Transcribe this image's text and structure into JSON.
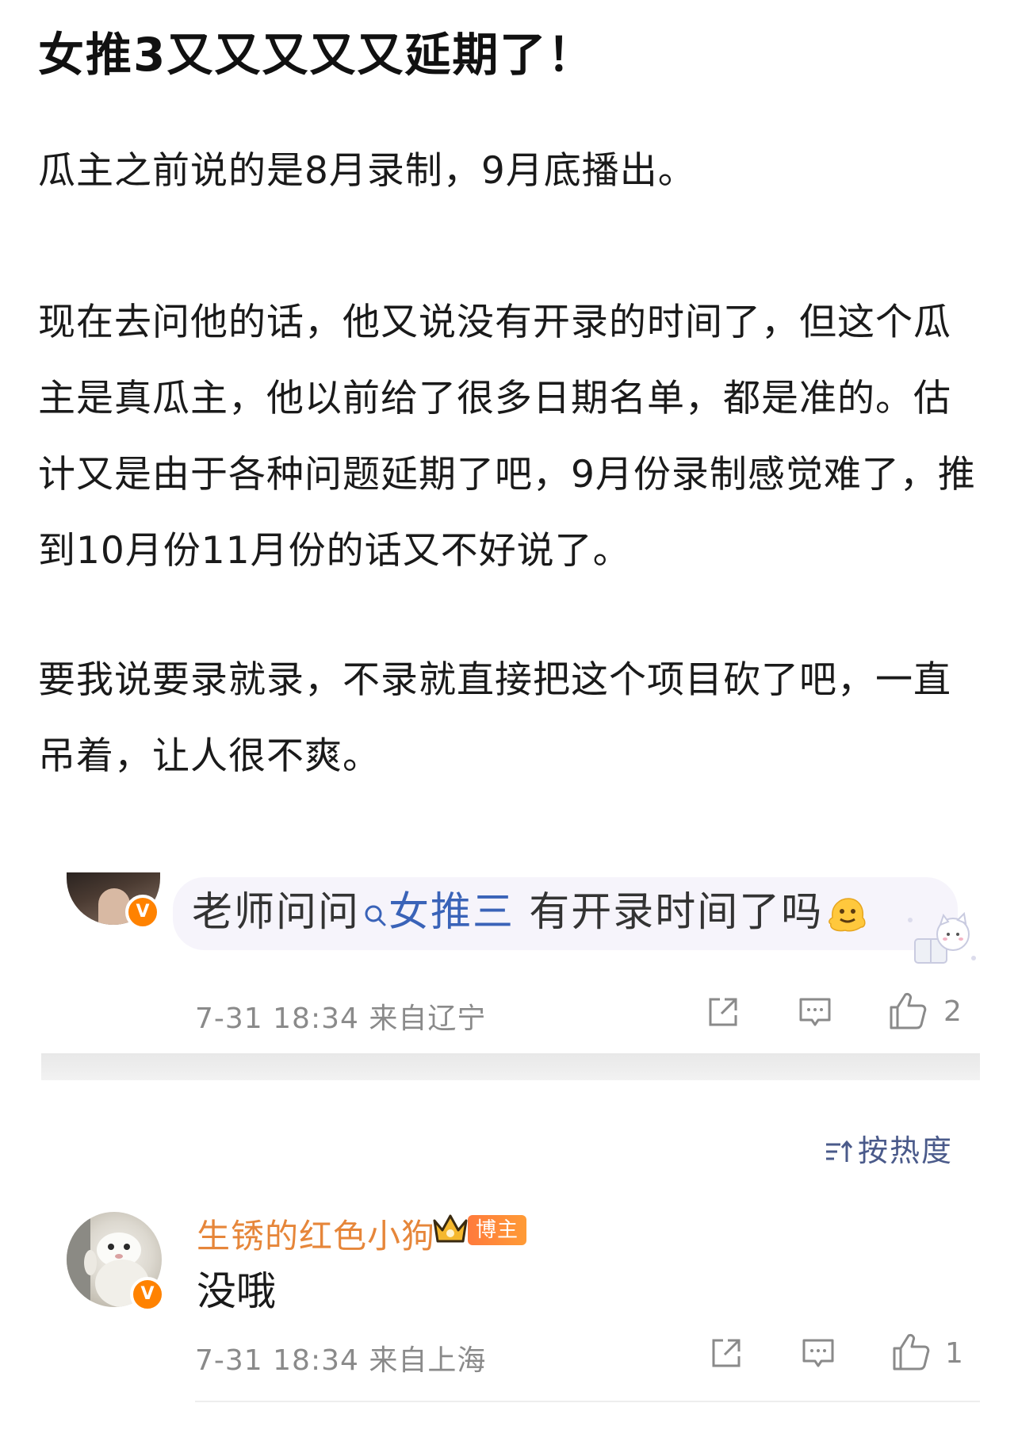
{
  "post": {
    "title": "女推3又又又又又延期了！",
    "paragraph1": "瓜主之前说的是8月录制，9月底播出。",
    "paragraph2": "现在去问他的话，他又说没有开录的时间了，但这个瓜主是真瓜主，他以前给了很多日期名单，都是准的。估计又是由于各种问题延期了吧，9月份录制感觉难了，推到10月份11月份的话又不好说了。",
    "paragraph3": "要我说要录就录，不录就直接把这个项目砍了吧，一直吊着，让人很不爽。"
  },
  "quoted_comment": {
    "text_before": "老师问问",
    "topic": "女推三",
    "text_after": " 有开录时间了吗",
    "emoji_icon": "melting-face-emoji",
    "time": "7-31 18:34",
    "location": "来自辽宁",
    "like_count": "2",
    "verified_badge": "V"
  },
  "sort": {
    "label": "按热度"
  },
  "reply": {
    "username": "生锈的红色小狗",
    "role_badge": "博主",
    "text": "没哦",
    "time": "7-31 18:34",
    "location": "来自上海",
    "like_count": "1",
    "verified_badge": "V"
  },
  "colors": {
    "username": "#e6863a",
    "topic": "#3a63b8",
    "meta": "#8a8a8a",
    "verified": "#ff8200"
  }
}
